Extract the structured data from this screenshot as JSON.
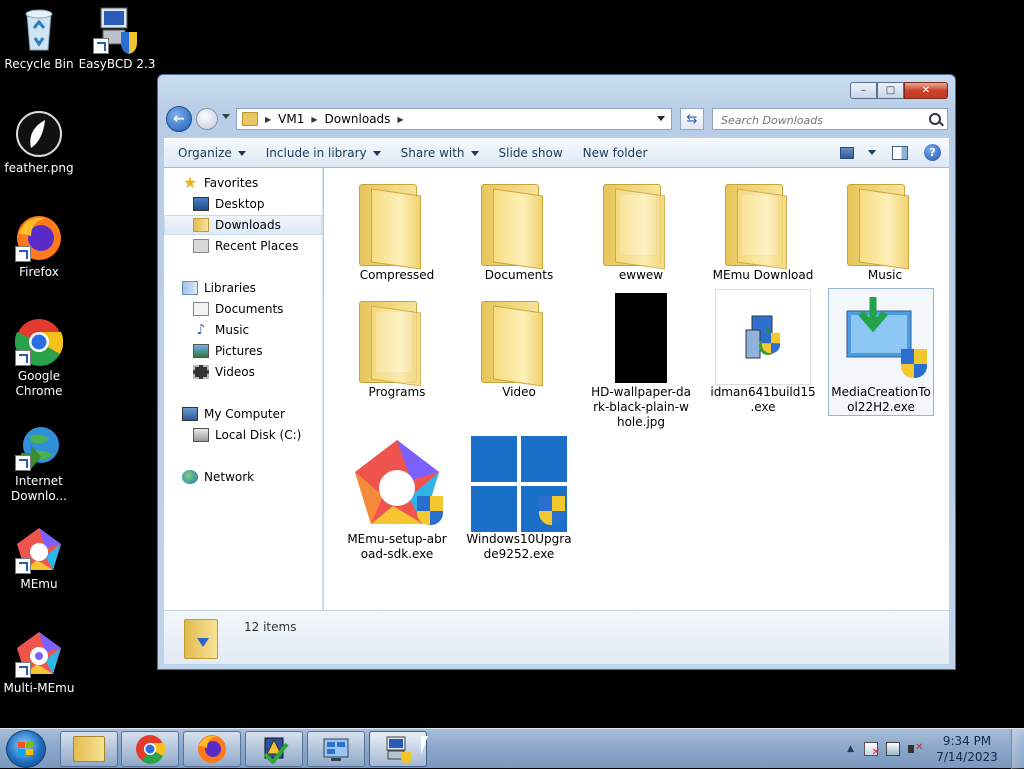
{
  "desktop": {
    "icons": [
      {
        "label": "Recycle Bin"
      },
      {
        "label": "EasyBCD 2.3"
      },
      {
        "label": "feather.png"
      },
      {
        "label": "Firefox"
      },
      {
        "label": "Google\nChrome"
      },
      {
        "label": "Internet\nDownlo..."
      },
      {
        "label": "MEmu"
      },
      {
        "label": "Multi-MEmu"
      }
    ]
  },
  "window": {
    "caption": {
      "minimize": "–",
      "maximize": "□",
      "close": "✕"
    },
    "address": {
      "crumbs": [
        "VM1",
        "Downloads"
      ]
    },
    "search": {
      "placeholder": "Search Downloads"
    },
    "toolbar": {
      "organize": "Organize",
      "include_in_library": "Include in library",
      "share_with": "Share with",
      "slide_show": "Slide show",
      "new_folder": "New folder"
    },
    "nav": {
      "favorites": "Favorites",
      "desktop": "Desktop",
      "downloads": "Downloads",
      "recent_places": "Recent Places",
      "libraries": "Libraries",
      "documents": "Documents",
      "music": "Music",
      "pictures": "Pictures",
      "videos": "Videos",
      "my_computer": "My Computer",
      "local_disk": "Local Disk (C:)",
      "network": "Network"
    },
    "files": [
      {
        "name": "Compressed",
        "type": "folder"
      },
      {
        "name": "Documents",
        "type": "folder"
      },
      {
        "name": "ewwew",
        "type": "folder"
      },
      {
        "name": "MEmu Download",
        "type": "folder"
      },
      {
        "name": "Music",
        "type": "folder"
      },
      {
        "name": "Programs",
        "type": "folder"
      },
      {
        "name": "Video",
        "type": "folder"
      },
      {
        "name": "HD-wallpaper-da\nrk-black-plain-w\nhole.jpg",
        "type": "image"
      },
      {
        "name": "idman641build15\n.exe",
        "type": "exe"
      },
      {
        "name": "MediaCreationTo\nol22H2.exe",
        "type": "exe"
      },
      {
        "name": "MEmu-setup-abr\noad-sdk.exe",
        "type": "exe"
      },
      {
        "name": "Windows10Upgra\nde9252.exe",
        "type": "exe"
      }
    ],
    "status": {
      "item_count": "12 items"
    }
  },
  "taskbar": {
    "clock_time": "9:34 PM",
    "clock_date": "7/14/2023",
    "tray_arrow": "▲"
  }
}
